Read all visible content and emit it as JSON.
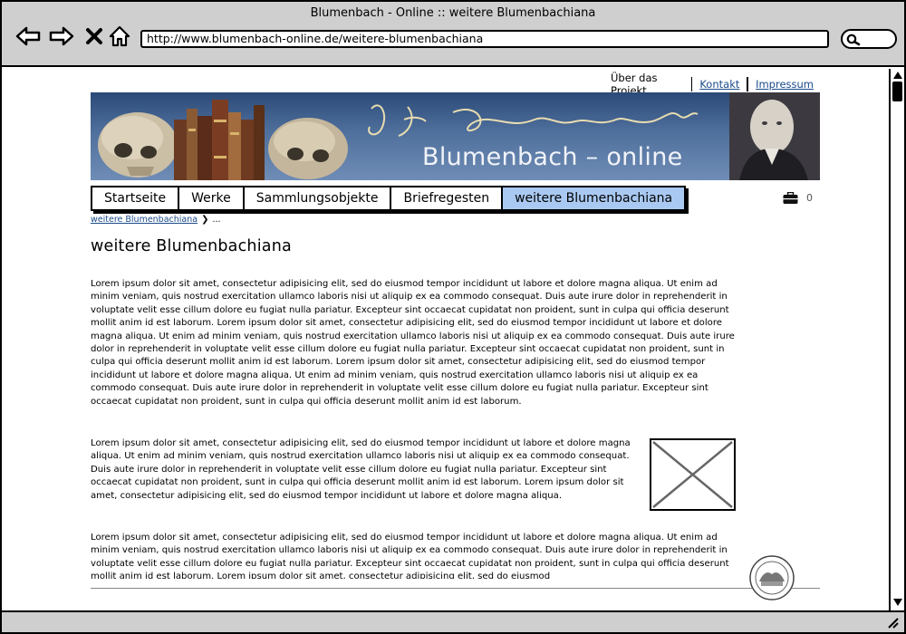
{
  "window": {
    "title": "Blumenbach - Online :: weitere Blumenbachiana",
    "url": "http://www.blumenbach-online.de/weitere-blumenbachiana"
  },
  "top_links": {
    "about": "Über das Projekt",
    "contact": "Kontakt",
    "imprint": "Impressum"
  },
  "banner": {
    "title": "Blumenbach – online"
  },
  "nav": {
    "tabs": [
      {
        "label": "Startseite"
      },
      {
        "label": "Werke"
      },
      {
        "label": "Sammlungsobjekte"
      },
      {
        "label": "Briefregesten"
      },
      {
        "label": "weitere Blumenbachiana",
        "active": true
      }
    ]
  },
  "cart": {
    "icon": "briefcase-icon",
    "count": "0"
  },
  "breadcrumb": {
    "link": "weitere Blumenbachiana",
    "separator": "❯",
    "current": "..."
  },
  "content": {
    "title": "weitere Blumenbachiana",
    "paragraph1": "Lorem ipsum dolor sit amet, consectetur adipisicing elit, sed do eiusmod tempor incididunt ut labore et dolore magna aliqua. Ut enim ad minim veniam, quis nostrud exercitation ullamco laboris nisi ut aliquip ex ea commodo consequat. Duis aute irure dolor in reprehenderit in voluptate velit esse cillum dolore eu fugiat nulla pariatur. Excepteur sint occaecat cupidatat non proident, sunt in culpa qui officia deserunt mollit anim id est laborum. Lorem ipsum dolor sit amet, consectetur adipisicing elit, sed do eiusmod tempor incididunt ut labore et dolore magna aliqua. Ut enim ad minim veniam, quis nostrud exercitation ullamco laboris nisi ut aliquip ex ea commodo consequat. Duis aute irure dolor in reprehenderit in voluptate velit esse cillum dolore eu fugiat nulla pariatur. Excepteur sint occaecat cupidatat non proident, sunt in culpa qui officia deserunt mollit anim id est laborum. Lorem ipsum dolor sit amet, consectetur adipisicing elit, sed do eiusmod tempor incididunt ut labore et dolore magna aliqua. Ut enim ad minim veniam, quis nostrud exercitation ullamco laboris nisi ut aliquip ex ea commodo consequat. Duis aute irure dolor in reprehenderit in voluptate velit esse cillum dolore eu fugiat nulla pariatur. Excepteur sint occaecat cupidatat non proident, sunt in culpa qui officia deserunt mollit anim id est laborum.",
    "paragraph2": "Lorem ipsum dolor sit amet, consectetur adipisicing elit, sed do eiusmod tempor incididunt ut labore et dolore magna aliqua. Ut enim ad minim veniam, quis nostrud exercitation ullamco laboris nisi ut aliquip ex ea commodo consequat. Duis aute irure dolor in reprehenderit in voluptate velit esse cillum dolore eu fugiat nulla pariatur. Excepteur sint occaecat cupidatat non proident, sunt in culpa qui officia deserunt mollit anim id est laborum. Lorem ipsum dolor sit amet, consectetur adipisicing elit, sed do eiusmod tempor incididunt ut labore et dolore magna aliqua.",
    "paragraph3": "Lorem ipsum dolor sit amet, consectetur adipisicing elit, sed do eiusmod tempor incididunt ut labore et dolore magna aliqua. Ut enim ad minim veniam, quis nostrud exercitation ullamco laboris nisi ut aliquip ex ea commodo consequat. Duis aute irure dolor in reprehenderit in voluptate velit esse cillum dolore eu fugiat nulla pariatur. Excepteur sint occaecat cupidatat non proident, sunt in culpa qui officia deserunt mollit anim id est laborum. Lorem ipsum dolor sit amet, consectetur adipisicing elit, sed do eiusmod"
  },
  "colors": {
    "active_tab": "#a9c9f2",
    "link": "#1a4a8a",
    "chrome": "#cfcfcf",
    "banner": "#4f6f9c"
  }
}
